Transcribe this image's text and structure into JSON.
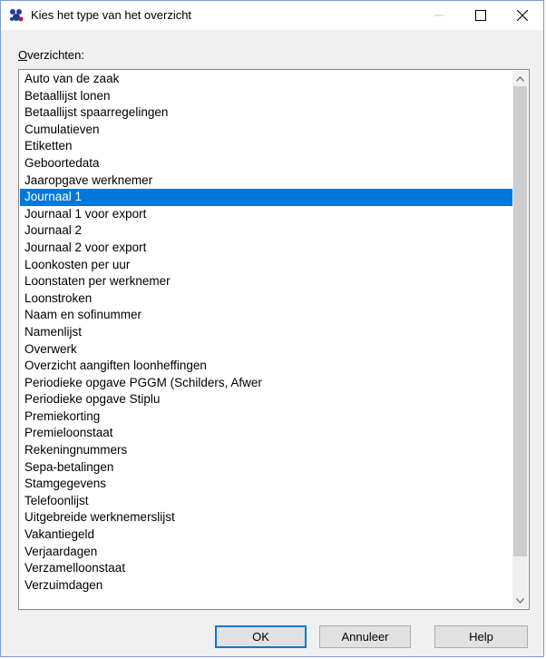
{
  "window": {
    "title": "Kies het type van het overzicht",
    "icon": "app-logo-icon"
  },
  "list": {
    "label_accesskey": "O",
    "label_rest": "verzichten:",
    "selected_index": 7,
    "items": [
      "Auto van de zaak",
      "Betaallijst lonen",
      "Betaallijst spaarregelingen",
      "Cumulatieven",
      "Etiketten",
      "Geboortedata",
      "Jaaropgave werknemer",
      "Journaal 1",
      "Journaal 1 voor export",
      "Journaal 2",
      "Journaal 2 voor export",
      "Loonkosten per uur",
      "Loonstaten per werknemer",
      "Loonstroken",
      "Naam en sofinummer",
      "Namenlijst",
      "Overwerk",
      "Overzicht aangiften loonheffingen",
      "Periodieke opgave PGGM (Schilders, Afwer",
      "Periodieke opgave Stiplu",
      "Premiekorting",
      "Premieloonstaat",
      "Rekeningnummers",
      "Sepa-betalingen",
      "Stamgegevens",
      "Telefoonlijst",
      "Uitgebreide werknemerslijst",
      "Vakantiegeld",
      "Verjaardagen",
      "Verzamelloonstaat",
      "Verzuimdagen"
    ]
  },
  "buttons": {
    "ok": "OK",
    "cancel": "Annuleer",
    "help": "Help"
  },
  "colors": {
    "selection": "#0078d7",
    "scroll_thumb": "#cdcdcd",
    "dialog_bg": "#f0f0f0"
  }
}
